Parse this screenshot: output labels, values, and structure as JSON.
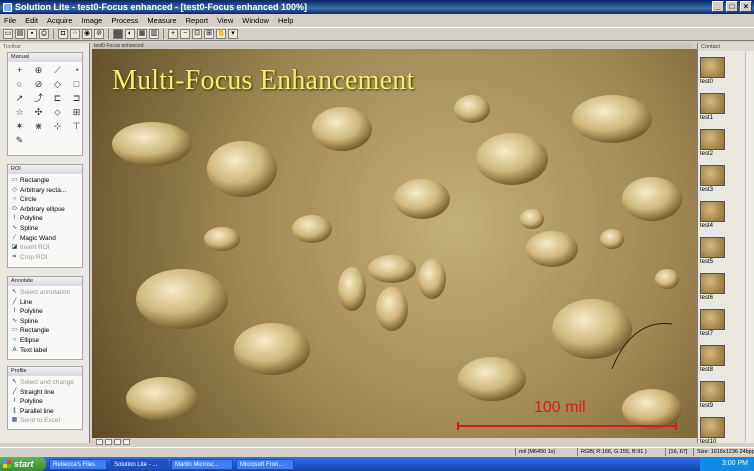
{
  "window": {
    "title": "Solution Lite - test0-Focus enhanced - [test0-Focus enhanced 100%]"
  },
  "menu": [
    "File",
    "Edit",
    "Acquire",
    "Image",
    "Process",
    "Measure",
    "Report",
    "View",
    "Window",
    "Help"
  ],
  "toolbar_icons": [
    "new-icon",
    "open-icon",
    "save-icon",
    "print-icon",
    "camera-icon",
    "dots-icon",
    "circle-icon",
    "stop-icon",
    "palette-icon",
    "grayscale-icon",
    "grid-icon",
    "table-icon",
    "zoom-in-icon",
    "zoom-out-icon",
    "zoom-fit-icon",
    "zoom-actual-icon",
    "hand-icon",
    "dropdown-icon"
  ],
  "left_panel": {
    "tab_label": "Toolbar",
    "manual": {
      "title": "Manual",
      "tools": [
        "+",
        "⊕",
        "⟋",
        "◔",
        "○",
        "⊘",
        "◇",
        "□",
        "↗",
        "⤴",
        "⊏",
        "⊐",
        "☆",
        "✣",
        "⬦",
        "⊞",
        "✶",
        "⋇",
        "⊹",
        "⊤",
        "✎"
      ]
    },
    "roi": {
      "title": "ROI",
      "items": [
        {
          "label": "Rectangle",
          "enabled": true
        },
        {
          "label": "Arbitrary recta...",
          "enabled": true
        },
        {
          "label": "Circle",
          "enabled": true
        },
        {
          "label": "Arbitrary ellipse",
          "enabled": true
        },
        {
          "label": "Polyline",
          "enabled": true
        },
        {
          "label": "Spline",
          "enabled": true
        },
        {
          "label": "Magic Wand",
          "enabled": true
        },
        {
          "label": "Invert ROI",
          "enabled": false
        },
        {
          "label": "Crop ROI",
          "enabled": false
        }
      ]
    },
    "annotate": {
      "title": "Annotate",
      "items": [
        {
          "label": "Select annotation",
          "enabled": false
        },
        {
          "label": "Line",
          "enabled": true
        },
        {
          "label": "Polyline",
          "enabled": true
        },
        {
          "label": "Spline",
          "enabled": true
        },
        {
          "label": "Rectangle",
          "enabled": true
        },
        {
          "label": "Ellipse",
          "enabled": true
        },
        {
          "label": "Text label",
          "enabled": true
        }
      ]
    },
    "profile": {
      "title": "Profile",
      "items": [
        {
          "label": "Select and change",
          "enabled": false
        },
        {
          "label": "Straight line",
          "enabled": true
        },
        {
          "label": "Polyline",
          "enabled": true
        },
        {
          "label": "Parallel line",
          "enabled": true
        },
        {
          "label": "Send to Excel",
          "enabled": false
        }
      ]
    }
  },
  "document": {
    "tab_label": "test0-Focus enhanced",
    "overlay_title": "Multi-Focus Enhancement",
    "scale_label": "100 mil"
  },
  "right_panel": {
    "title": "Contact",
    "thumbnails": [
      "test0",
      "test1",
      "test2",
      "test3",
      "test4",
      "test5",
      "test6",
      "test7",
      "test8",
      "test9",
      "test10"
    ]
  },
  "status": {
    "units": "mil (M6450 1x)",
    "color": "RGB( R:166, G:155, B:91 )",
    "position": "[16, 67]",
    "size": "Size: 1616x1236 24bpp"
  },
  "taskbar": {
    "start": "start",
    "tasks": [
      "Rebecca's Files",
      "Solution Lite - ...",
      "Martin Microsc...",
      "Microsoft Fron..."
    ],
    "clock": "3:00 PM"
  }
}
